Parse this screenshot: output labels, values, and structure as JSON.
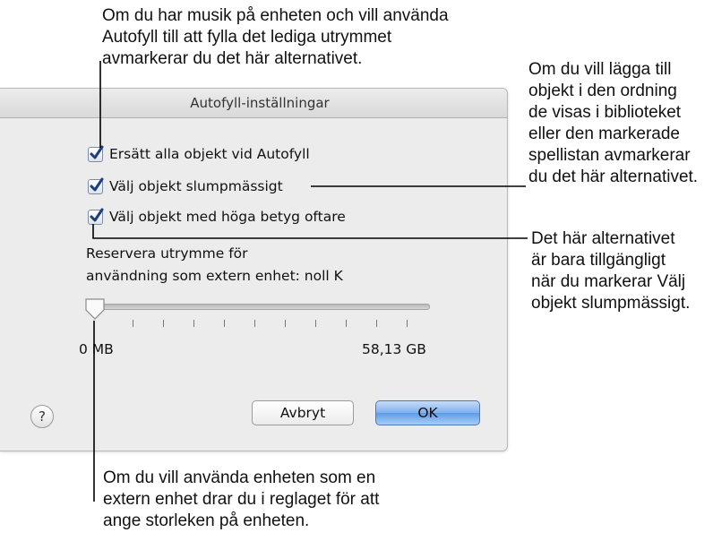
{
  "callouts": {
    "top": "Om du har musik på enheten och vill använda\nAutofyll till att fylla det lediga utrymmet\navmarkerar du det här alternativet.",
    "right_upper": "Om du vill lägga till\nobjekt i den ordning\nde visas i biblioteket\neller den markerade\nspellistan avmarkerar\ndu det här alternativet.",
    "right_lower": "Det här alternativet\när bara tillgängligt\nnär du markerar Välj\nobjekt slumpmässigt.",
    "bottom": "Om du vill använda enheten som en\nextern enhet drar du i reglaget för att\nange storleken på enheten."
  },
  "dialog": {
    "title": "Autofyll-inställningar",
    "options": [
      {
        "label": "Ersätt alla objekt vid Autofyll",
        "checked": true
      },
      {
        "label": "Välj objekt slumpmässigt",
        "checked": true
      },
      {
        "label": "Välj objekt med höga betyg oftare",
        "checked": true
      }
    ],
    "reserve_line1": "Reservera utrymme för",
    "reserve_line2": "användning som extern enhet: noll K",
    "slider": {
      "min_label": "0 MB",
      "max_label": "58,13 GB",
      "value_fraction": 0
    },
    "help_label": "?",
    "cancel_label": "Avbryt",
    "ok_label": "OK"
  },
  "colors": {
    "accent_button": "#6fa6ec",
    "checkmark": "#1f3f7a",
    "dialog_bg": "#ececec"
  }
}
